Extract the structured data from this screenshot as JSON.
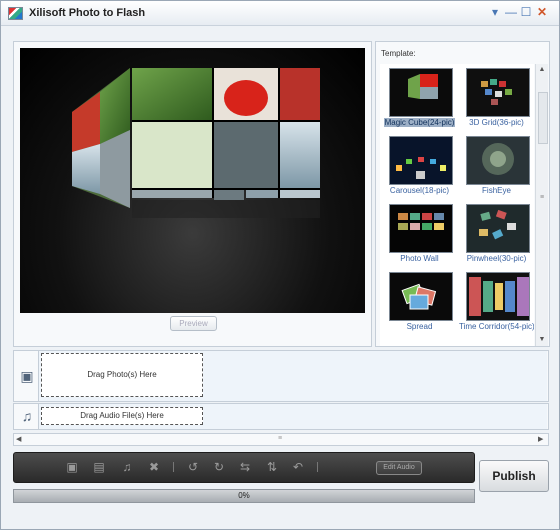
{
  "window": {
    "title": "Xilisoft Photo to Flash",
    "controls": {
      "menu": "▾",
      "minimize": "—",
      "maximize": "☐",
      "close": "✕"
    }
  },
  "preview": {
    "button_label": "Preview"
  },
  "templates": {
    "label": "Template:",
    "items": [
      {
        "label": "Magic Cube(24-pic)",
        "selected": true
      },
      {
        "label": "3D Grid(36-pic)",
        "selected": false
      },
      {
        "label": "Carousel(18-pic)",
        "selected": false
      },
      {
        "label": "FishEye",
        "selected": false
      },
      {
        "label": "Photo Wall",
        "selected": false
      },
      {
        "label": "Pinwheel(30-pic)",
        "selected": false
      },
      {
        "label": "Spread",
        "selected": false
      },
      {
        "label": "Time Corridor(54-pic)",
        "selected": false
      }
    ]
  },
  "tracks": {
    "photo_drop": "Drag Photo(s) Here",
    "audio_drop": "Drag Audio File(s) Here"
  },
  "toolbar": {
    "tools": [
      {
        "name": "add-photo-icon",
        "glyph": "▣"
      },
      {
        "name": "add-photo-folder-icon",
        "glyph": "▤"
      },
      {
        "name": "add-audio-icon",
        "glyph": "♫"
      },
      {
        "name": "delete-icon",
        "glyph": "✖"
      },
      {
        "name": "rotate-left-icon",
        "glyph": "↺"
      },
      {
        "name": "rotate-right-icon",
        "glyph": "↻"
      },
      {
        "name": "flip-horizontal-icon",
        "glyph": "⇆"
      },
      {
        "name": "flip-vertical-icon",
        "glyph": "⇅"
      },
      {
        "name": "undo-icon",
        "glyph": "↶"
      }
    ],
    "edit_audio_label": "Edit Audio"
  },
  "publish_label": "Publish",
  "progress": {
    "value": 0,
    "text": "0%"
  }
}
